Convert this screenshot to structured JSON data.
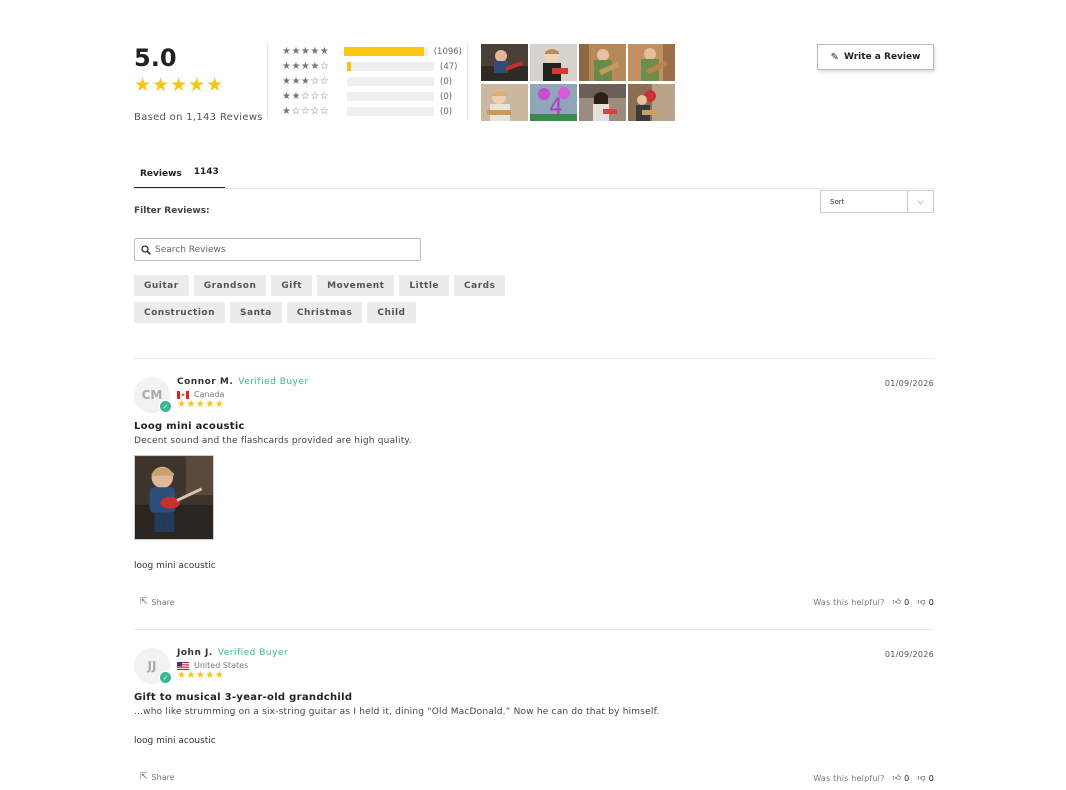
{
  "summary": {
    "average": "5.0",
    "stars": "★★★★★",
    "based_on": "Based on 1,143 Reviews"
  },
  "histogram": [
    {
      "stars": "★★★★★",
      "count": "(1096)",
      "fraction": 0.959
    },
    {
      "stars": "★★★★☆",
      "count": "(47)",
      "fraction": 0.041
    },
    {
      "stars": "★★★☆☆",
      "count": "(0)",
      "fraction": 0
    },
    {
      "stars": "★★☆☆☆",
      "count": "(0)",
      "fraction": 0
    },
    {
      "stars": "★☆☆☆☆",
      "count": "(0)",
      "fraction": 0
    }
  ],
  "write_review": "Write a Review",
  "tabs": {
    "reviews_label": "Reviews",
    "reviews_count": "1143"
  },
  "filter_label": "Filter Reviews:",
  "sort": {
    "label": "Sort"
  },
  "search": {
    "placeholder": "Search Reviews"
  },
  "chips": {
    "row1": [
      "Guitar",
      "Grandson",
      "Gift",
      "Movement",
      "Little",
      "Cards"
    ],
    "row2": [
      "Construction",
      "Santa",
      "Christmas",
      "Child"
    ]
  },
  "reviews": [
    {
      "initials": "CM",
      "name": "Connor M.",
      "verified": "Verified Buyer",
      "country": "Canada",
      "stars": "★★★★★",
      "date": "01/09/2026",
      "title": "Loog mini acoustic",
      "body": "Decent sound and the flashcards provided are high quality.",
      "product": "loog mini acoustic",
      "share": "Share",
      "helpful": "Was this helpful?",
      "up": "0",
      "down": "0"
    },
    {
      "initials": "JJ",
      "name": "John J.",
      "verified": "Verified Buyer",
      "country": "United States",
      "stars": "★★★★★",
      "date": "01/09/2026",
      "title": "Gift to musical 3-year-old grandchild",
      "body": "...who like strumming on a six-string guitar as I held it, dining “Old MacDonald.” Now he can do that by himself.",
      "product": "loog mini acoustic",
      "share": "Share",
      "helpful": "Was this helpful?",
      "up": "0",
      "down": "0"
    }
  ],
  "colors": {
    "star": "#f5c518",
    "bar": "#f9c80e",
    "verified": "#3ab891"
  }
}
